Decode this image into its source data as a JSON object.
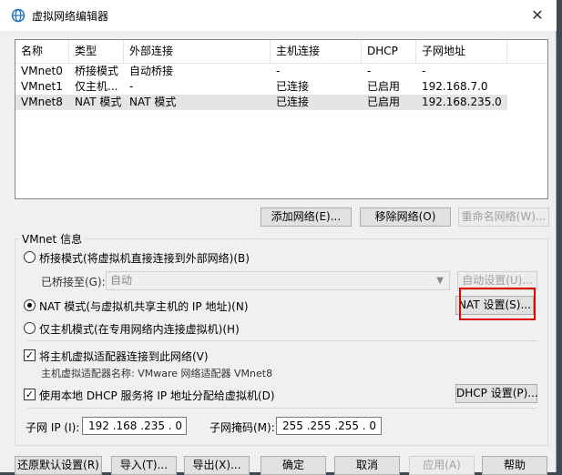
{
  "window": {
    "title": "虚拟网络编辑器",
    "close": "✕"
  },
  "table": {
    "headers": [
      "名称",
      "类型",
      "外部连接",
      "主机连接",
      "DHCP",
      "子网地址"
    ],
    "rows": [
      [
        "VMnet0",
        "桥接模式",
        "自动桥接",
        "-",
        "-",
        "-"
      ],
      [
        "VMnet1",
        "仅主机...",
        "-",
        "已连接",
        "已启用",
        "192.168.7.0"
      ],
      [
        "VMnet8",
        "NAT 模式",
        "NAT 模式",
        "已连接",
        "已启用",
        "192.168.235.0"
      ]
    ]
  },
  "table_buttons": {
    "add": "添加网络(E)...",
    "remove": "移除网络(O)",
    "rename": "重命名网络(W)..."
  },
  "vmnet_info": {
    "group_label": "VMnet 信息",
    "bridged_label": "桥接模式(将虚拟机直接连接到外部网络)(B)",
    "bridged_to_label": "已桥接至(G):",
    "bridged_to_value": "自动",
    "auto_settings": "自动设置(U)...",
    "nat_label": "NAT 模式(与虚拟机共享主机的 IP 地址)(N)",
    "nat_settings": "NAT 设置(S)...",
    "hostonly_label": "仅主机模式(在专用网络内连接虚拟机)(H)",
    "connect_adapter_label": "将主机虚拟适配器连接到此网络(V)",
    "adapter_name_label": "主机虚拟适配器名称: VMware 网络适配器 VMnet8",
    "dhcp_label": "使用本地 DHCP 服务将 IP 地址分配给虚拟机(D)",
    "dhcp_settings": "DHCP 设置(P)...",
    "subnet_ip_label": "子网 IP (I):",
    "subnet_ip_value": "192 .168 .235 . 0",
    "subnet_mask_label": "子网掩码(M):",
    "subnet_mask_value": "255 .255 .255 . 0",
    "selected_mode": "nat",
    "connect_adapter_checked": true,
    "dhcp_checked": true
  },
  "footer": {
    "restore": "还原默认设置(R)",
    "import": "导入(T)...",
    "export": "导出(X)...",
    "ok": "确定",
    "cancel": "取消",
    "apply": "应用(A)",
    "help": "帮助"
  },
  "colors": {
    "highlight": "#e00000",
    "title_icon": "#1e73be"
  }
}
